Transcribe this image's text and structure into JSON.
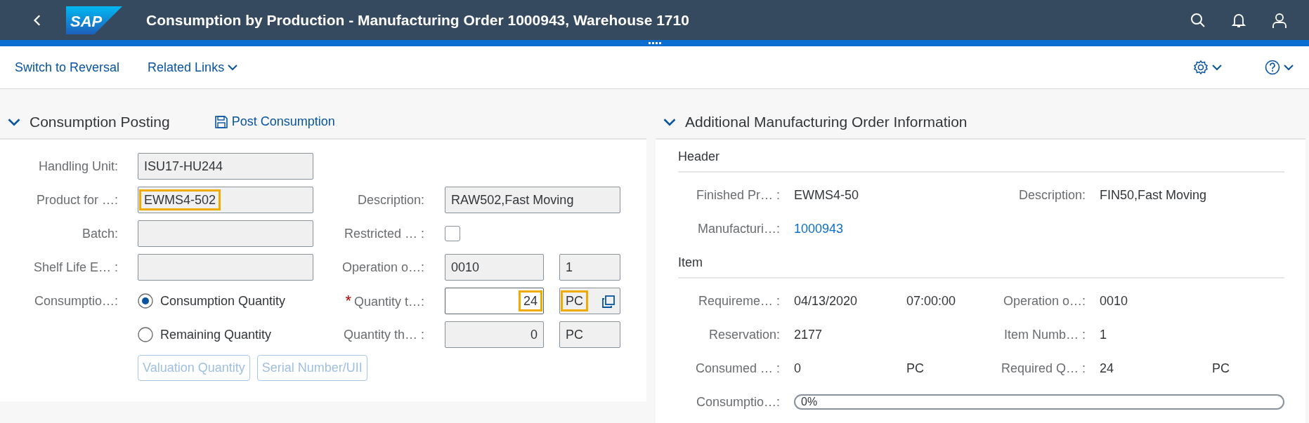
{
  "shell": {
    "logo": "SAP",
    "title": "Consumption by Production - Manufacturing Order 1000943, Warehouse 1710"
  },
  "toolbar": {
    "links": [
      {
        "label": "Switch to Reversal",
        "kind": "link"
      },
      {
        "label": "Related Links",
        "kind": "menu"
      }
    ]
  },
  "posting": {
    "title": "Consumption Posting",
    "action": "Post Consumption",
    "rows": [
      {
        "left": {
          "label": "Handling Unit:",
          "kind": "input",
          "value": "ISU17-HU244",
          "highlighted": false
        }
      },
      {
        "left": {
          "label": "Product for …:",
          "kind": "input",
          "value": "EWMS4-502",
          "highlighted": true
        },
        "right": {
          "label": "Description:",
          "kind": "input",
          "value": "RAW502,Fast Moving",
          "highlighted": false
        }
      },
      {
        "left": {
          "label": "Batch:",
          "kind": "input",
          "highlighted": false
        },
        "right": {
          "label": "Restricted …  :",
          "kind": "checkbox",
          "checked": false
        }
      },
      {
        "left": {
          "label": "Shelf Life E… :",
          "kind": "input",
          "highlighted": false
        },
        "right": {
          "label": "Operation o…:",
          "kind": "pair",
          "value_help": false,
          "parts": [
            {
              "value": "0010",
              "numeric": false,
              "editable": false,
              "highlighted": false
            },
            {
              "value": "1",
              "numeric": false,
              "editable": false,
              "highlighted": false
            }
          ]
        }
      },
      {
        "left": {
          "label": "Consumptio…:",
          "kind": "radio",
          "option": "Consumption Quantity",
          "selected": true
        },
        "right": {
          "label": "Quantity t…:",
          "required_mark": "*",
          "kind": "pair",
          "value_help": true,
          "parts": [
            {
              "value": "24",
              "numeric": true,
              "editable": true,
              "highlighted": true
            },
            {
              "value": "PC",
              "numeric": false,
              "editable": false,
              "highlighted": true
            }
          ]
        }
      },
      {
        "left": {
          "kind": "radio",
          "option": "Remaining Quantity",
          "selected": false
        },
        "right": {
          "label": "Quantity th… :",
          "kind": "pair",
          "value_help": false,
          "parts": [
            {
              "value": "0",
              "numeric": true,
              "editable": false,
              "highlighted": false
            },
            {
              "value": "PC",
              "numeric": false,
              "editable": false,
              "highlighted": false
            }
          ]
        }
      }
    ],
    "buttons": [
      {
        "label": "Valuation Quantity",
        "disabled": true
      },
      {
        "label": "Serial Number/UII",
        "disabled": true
      }
    ]
  },
  "info": {
    "title": "Additional Manufacturing Order Information",
    "sections": [
      {
        "title": "Header",
        "rows": [
          [
            {
              "label": "Finished Pr… :",
              "value": "EWMS4-50",
              "kind": "text"
            },
            {
              "label": "Description:",
              "value": "FIN50,Fast Moving",
              "kind": "text"
            }
          ],
          [
            {
              "label": "Manufacturi…:",
              "value": "1000943",
              "kind": "link"
            }
          ]
        ]
      },
      {
        "title": "Item",
        "rows": [
          [
            {
              "label": "Requireme… :",
              "value": "04/13/2020",
              "extra": "07:00:00",
              "kind": "text"
            },
            {
              "label": "Operation o…:",
              "value": "0010",
              "kind": "text"
            }
          ],
          [
            {
              "label": "Reservation:",
              "value": "2177",
              "kind": "text"
            },
            {
              "label": "Item Numb… :",
              "value": "1",
              "kind": "text"
            }
          ],
          [
            {
              "label": "Consumed … :",
              "value": "0",
              "extra": "PC",
              "kind": "text"
            },
            {
              "label": "Required Q… :",
              "value": "24",
              "extra": "PC",
              "kind": "text"
            }
          ],
          [
            {
              "label": "Consumptio…:",
              "kind": "progress",
              "level": 0,
              "reading": "0%"
            }
          ]
        ]
      }
    ]
  }
}
